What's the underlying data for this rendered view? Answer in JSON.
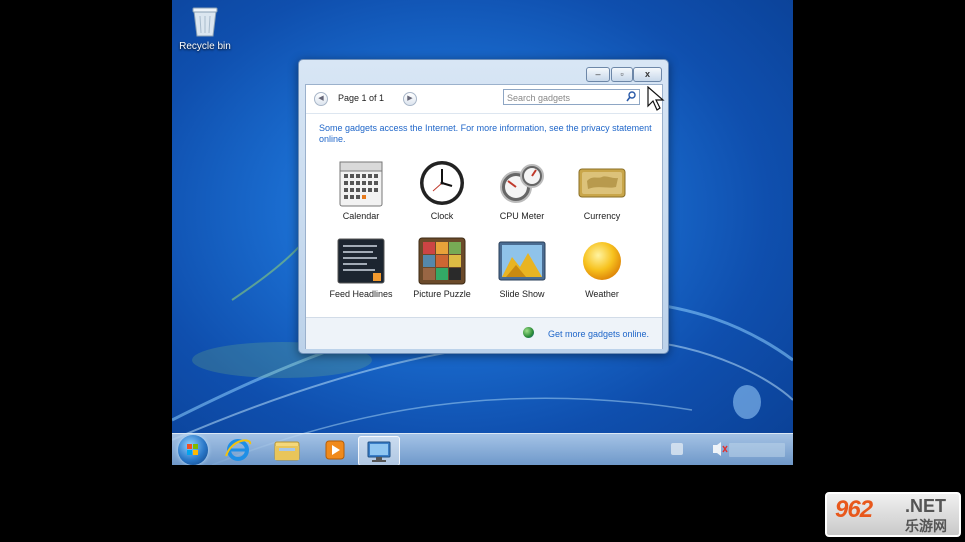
{
  "desktop": {
    "recycle_bin_label": "Recycle bin"
  },
  "gadget_window": {
    "controls": {
      "minimize": "–",
      "maximize": "▫",
      "close": "x"
    },
    "pager": {
      "prev": "◀",
      "next": "▶",
      "label": "Page 1 of 1"
    },
    "search_placeholder": "Search gadgets",
    "notice": "Some gadgets access the Internet. For more information, see the privacy statement online.",
    "gadgets": [
      {
        "label": "Calendar",
        "icon": "calendar-icon"
      },
      {
        "label": "Clock",
        "icon": "clock-icon"
      },
      {
        "label": "CPU Meter",
        "icon": "cpu-meter-icon"
      },
      {
        "label": "Currency",
        "icon": "currency-icon"
      },
      {
        "label": "Feed Headlines",
        "icon": "feed-headlines-icon"
      },
      {
        "label": "Picture Puzzle",
        "icon": "picture-puzzle-icon"
      },
      {
        "label": "Slide Show",
        "icon": "slide-show-icon"
      },
      {
        "label": "Weather",
        "icon": "weather-icon"
      }
    ],
    "footer_link": "Get more gadgets online."
  },
  "taskbar": {
    "pinned": [
      "internet-explorer-icon",
      "file-explorer-icon",
      "media-player-icon",
      "gadgets-icon"
    ],
    "clock_text": ""
  },
  "watermark": {
    "number": "962",
    "suffix": ".NET",
    "chinese": "乐游网"
  },
  "colors": {
    "link": "#1f66c9",
    "accent": "#1a6ccf",
    "watermark_orange": "#e8581c"
  }
}
